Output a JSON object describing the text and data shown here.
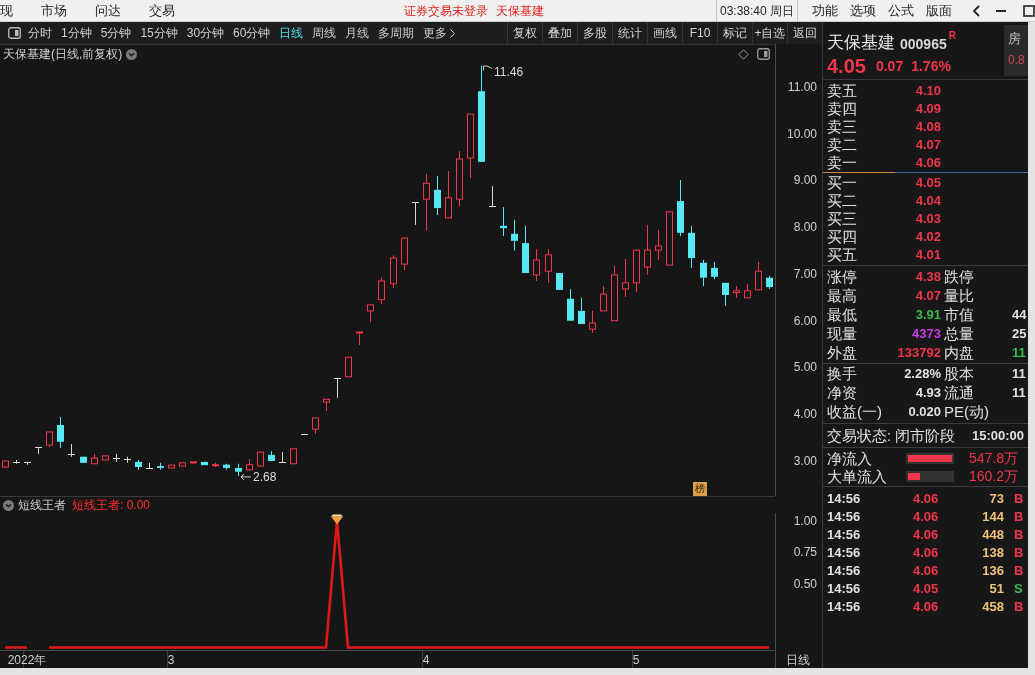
{
  "menu_bar": {
    "items": [
      "现",
      "市场",
      "问达",
      "交易"
    ],
    "login_status": "证券交易未登录",
    "stock": "天保基建",
    "clock": "03:38:40 周日",
    "options": [
      "功能",
      "选项",
      "公式",
      "版面"
    ]
  },
  "toolbar": {
    "periods": [
      {
        "label": "分时",
        "selected": false
      },
      {
        "label": "1分钟",
        "selected": false
      },
      {
        "label": "5分钟",
        "selected": false
      },
      {
        "label": "15分钟",
        "selected": false
      },
      {
        "label": "30分钟",
        "selected": false
      },
      {
        "label": "60分钟",
        "selected": false
      },
      {
        "label": "日线",
        "selected": true
      },
      {
        "label": "周线",
        "selected": false
      },
      {
        "label": "月线",
        "selected": false
      },
      {
        "label": "多周期",
        "selected": false
      },
      {
        "label": "更多",
        "selected": false
      }
    ],
    "actions": [
      "复权",
      "叠加",
      "多股",
      "统计",
      "画线",
      "F10",
      "标记",
      "+自选",
      "返回"
    ]
  },
  "chart": {
    "title": "天保基建(日线,前复权)",
    "badge": "榜",
    "indicator_name": "短线王者",
    "indicator_reading": "短线王者: 0.00",
    "period_label": "日线",
    "chart_data": [
      {
        "type": "candlestick",
        "categories": [
          null,
          null,
          null,
          null,
          null,
          null,
          null,
          null,
          null,
          null,
          null,
          null,
          null,
          null,
          null,
          null,
          null,
          null,
          null,
          null,
          null,
          null,
          null,
          null,
          null,
          null,
          null,
          null,
          null,
          null,
          null,
          null,
          null,
          null,
          null,
          null,
          null,
          null,
          null,
          null,
          null,
          null,
          null,
          null,
          null,
          null,
          null,
          null,
          null,
          null,
          null,
          null,
          null,
          null,
          null,
          null,
          null,
          null,
          null,
          null,
          null,
          null,
          null,
          null,
          null,
          null,
          null,
          null,
          null,
          null
        ],
        "ohlc": [
          [
            2.87,
            3.0,
            2.85,
            3.0
          ],
          [
            2.98,
            3.02,
            2.94,
            2.98
          ],
          [
            2.98,
            2.98,
            2.92,
            2.98
          ],
          [
            3.3,
            3.3,
            3.15,
            3.3
          ],
          [
            3.34,
            3.62,
            3.3,
            3.62
          ],
          [
            3.77,
            3.94,
            3.28,
            3.41
          ],
          [
            3.15,
            3.36,
            3.09,
            3.15
          ],
          [
            3.09,
            3.09,
            2.96,
            2.96
          ],
          [
            2.94,
            3.15,
            2.94,
            3.06
          ],
          [
            3.02,
            3.11,
            3.02,
            3.11
          ],
          [
            3.06,
            3.15,
            2.98,
            3.06
          ],
          [
            3.04,
            3.09,
            2.96,
            3.04
          ],
          [
            2.98,
            3.02,
            2.81,
            2.87
          ],
          [
            2.85,
            2.96,
            2.85,
            2.85
          ],
          [
            2.89,
            2.96,
            2.81,
            2.85
          ],
          [
            2.85,
            2.91,
            2.85,
            2.91
          ],
          [
            2.89,
            2.96,
            2.89,
            2.96
          ],
          [
            2.96,
            2.98,
            2.94,
            2.98
          ],
          [
            2.98,
            2.98,
            2.91,
            2.91
          ],
          [
            2.91,
            2.96,
            2.87,
            2.92
          ],
          [
            2.92,
            2.94,
            2.81,
            2.85
          ],
          [
            2.85,
            2.94,
            2.68,
            2.77
          ],
          [
            2.81,
            3.04,
            2.81,
            2.92
          ],
          [
            2.89,
            3.19,
            2.87,
            3.19
          ],
          [
            3.13,
            3.21,
            3.0,
            3.0
          ],
          [
            2.98,
            3.19,
            2.98,
            2.98
          ],
          [
            2.94,
            3.26,
            2.94,
            3.26
          ],
          [
            3.58,
            3.58,
            3.58,
            3.58
          ],
          [
            3.68,
            3.92,
            3.58,
            3.92
          ],
          [
            4.26,
            4.32,
            4.07,
            4.32
          ],
          [
            4.78,
            4.78,
            4.35,
            4.78
          ],
          [
            4.8,
            5.22,
            4.8,
            5.22
          ],
          [
            5.74,
            5.76,
            5.48,
            5.76
          ],
          [
            6.21,
            6.34,
            5.97,
            6.34
          ],
          [
            6.45,
            6.92,
            6.35,
            6.85
          ],
          [
            6.79,
            7.4,
            6.7,
            7.34
          ],
          [
            7.21,
            7.77,
            7.08,
            7.77
          ],
          [
            8.54,
            8.54,
            8.05,
            8.54
          ],
          [
            8.6,
            9.14,
            7.93,
            8.94
          ],
          [
            8.8,
            9.1,
            8.26,
            8.41
          ],
          [
            8.2,
            9.2,
            8.2,
            8.63
          ],
          [
            8.6,
            9.63,
            8.45,
            9.46
          ],
          [
            9.48,
            10.42,
            9.05,
            10.42
          ],
          [
            10.91,
            11.46,
            9.4,
            9.4
          ],
          [
            8.45,
            8.88,
            8.45,
            8.45
          ],
          [
            8.03,
            8.43,
            7.81,
            7.98
          ],
          [
            7.86,
            8.16,
            7.5,
            7.71
          ],
          [
            7.66,
            8.03,
            7.02,
            7.02
          ],
          [
            6.98,
            7.53,
            6.85,
            7.3
          ],
          [
            7.06,
            7.53,
            6.81,
            7.41
          ],
          [
            7.02,
            7.02,
            6.66,
            6.66
          ],
          [
            6.47,
            6.68,
            6.0,
            6.0
          ],
          [
            6.21,
            6.49,
            5.93,
            5.93
          ],
          [
            5.82,
            6.21,
            5.74,
            5.95
          ],
          [
            6.21,
            6.74,
            6.21,
            6.57
          ],
          [
            6.0,
            7.17,
            6.0,
            6.98
          ],
          [
            6.68,
            7.32,
            6.51,
            6.81
          ],
          [
            6.81,
            7.51,
            6.61,
            7.51
          ],
          [
            7.15,
            8.05,
            6.98,
            7.51
          ],
          [
            7.51,
            7.94,
            7.3,
            7.6
          ],
          [
            7.19,
            8.33,
            7.19,
            8.33
          ],
          [
            8.56,
            9.01,
            7.81,
            7.88
          ],
          [
            7.88,
            8.03,
            7.13,
            7.34
          ],
          [
            7.24,
            7.3,
            6.74,
            6.92
          ],
          [
            7.13,
            7.26,
            6.89,
            6.94
          ],
          [
            6.81,
            6.81,
            6.32,
            6.55
          ],
          [
            6.6,
            6.74,
            6.49,
            6.64
          ],
          [
            6.49,
            6.79,
            6.49,
            6.64
          ],
          [
            6.66,
            7.26,
            6.66,
            7.06
          ],
          [
            6.92,
            6.96,
            6.68,
            6.72
          ]
        ],
        "ylim": [
          2.25,
          11.92
        ],
        "yticks": [
          {
            "value": 11,
            "label": "11.00"
          },
          {
            "value": 10,
            "label": "10.00"
          },
          {
            "value": 9,
            "label": "9.00"
          },
          {
            "value": 8,
            "label": "8.00"
          },
          {
            "value": 7,
            "label": "7.00"
          },
          {
            "value": 6,
            "label": "6.00"
          },
          {
            "value": 5,
            "label": "5.00"
          },
          {
            "value": 4,
            "label": "4.00"
          },
          {
            "value": 3,
            "label": "3.00"
          }
        ],
        "annotations": [
          "11.46",
          "2.68"
        ]
      },
      {
        "type": "line",
        "color": "#e01818",
        "categories": [
          null,
          null,
          "2022年",
          null,
          null,
          null,
          null,
          null,
          null,
          null,
          null,
          null,
          null,
          null,
          null,
          "3",
          null,
          null,
          null,
          null,
          null,
          null,
          null,
          null,
          null,
          null,
          null,
          null,
          null,
          null,
          null,
          null,
          null,
          null,
          null,
          null,
          null,
          null,
          "4",
          null,
          null,
          null,
          null,
          null,
          null,
          null,
          null,
          null,
          null,
          null,
          null,
          null,
          null,
          null,
          null,
          null,
          null,
          "5",
          null,
          null,
          null,
          null,
          null,
          null,
          null,
          null,
          null,
          null,
          null,
          null
        ],
        "values": [
          0,
          0,
          0,
          null,
          0,
          0,
          0,
          0,
          0,
          0,
          0,
          0,
          0,
          0,
          0,
          0,
          0,
          0,
          0,
          0,
          0,
          0,
          0,
          0,
          0,
          0,
          0,
          0,
          0,
          0,
          1,
          0,
          0,
          0,
          0,
          0,
          0,
          0,
          0,
          0,
          0,
          0,
          0,
          0,
          0,
          0,
          0,
          0,
          0,
          0,
          0,
          0,
          0,
          0,
          0,
          0,
          0,
          0,
          0,
          0,
          0,
          0,
          0,
          0,
          0,
          0,
          0,
          0,
          0,
          0
        ],
        "ylim": [
          -0.02,
          1.06
        ],
        "yticks": [
          {
            "value": 1,
            "label": "1.00"
          },
          {
            "value": 0.75,
            "label": "0.75"
          },
          {
            "value": 0.5,
            "label": "0.50"
          }
        ]
      }
    ]
  },
  "quote": {
    "name": "天保基建",
    "code": "000965",
    "suffix": "R",
    "price": "4.05",
    "change": "0.07",
    "change_pct": "1.76%"
  },
  "side_tab": {
    "label": "房",
    "value": "0.8"
  },
  "order_book": {
    "asks": [
      {
        "label": "卖五",
        "price": "4.10"
      },
      {
        "label": "卖四",
        "price": "4.09"
      },
      {
        "label": "卖三",
        "price": "4.08"
      },
      {
        "label": "卖二",
        "price": "4.07"
      },
      {
        "label": "卖一",
        "price": "4.06"
      }
    ],
    "bids": [
      {
        "label": "买一",
        "price": "4.05"
      },
      {
        "label": "买二",
        "price": "4.04"
      },
      {
        "label": "买三",
        "price": "4.03"
      },
      {
        "label": "买四",
        "price": "4.02"
      },
      {
        "label": "买五",
        "price": "4.01"
      }
    ]
  },
  "stats": [
    [
      {
        "label": "涨停",
        "value": "4.38",
        "color": "#f0364b"
      },
      {
        "label": "跌停"
      }
    ],
    [
      {
        "label": "最高",
        "value": "4.07",
        "color": "#f0364b"
      },
      {
        "label": "量比"
      }
    ],
    [
      {
        "label": "最低",
        "value": "3.91",
        "color": "#3dbb4f"
      },
      {
        "label": "市值",
        "value": "44",
        "color": "#e2e2e2"
      }
    ],
    [
      {
        "label": "现量",
        "value": "4373",
        "color": "#c43de0"
      },
      {
        "label": "总量",
        "value": "25",
        "color": "#e2e2e2"
      }
    ],
    [
      {
        "label": "外盘",
        "value": "133792",
        "color": "#f0364b"
      },
      {
        "label": "内盘",
        "value": "11",
        "color": "#3dbb4f"
      }
    ]
  ],
  "fundamentals": [
    [
      {
        "label": "换手",
        "value": "2.28%"
      },
      {
        "label": "股本",
        "value": "11"
      }
    ],
    [
      {
        "label": "净资",
        "value": "4.93"
      },
      {
        "label": "流通",
        "value": "11"
      }
    ],
    [
      {
        "label": "收益(一)",
        "value": "0.020"
      },
      {
        "label": "PE(动)"
      }
    ]
  ],
  "trade_status": {
    "label": "交易状态: 闭市阶段",
    "time": "15:00:00"
  },
  "flows": [
    {
      "label": "净流入",
      "level": 1.0,
      "value": "547.8万"
    },
    {
      "label": "大单流入",
      "level": 0.28,
      "value": "160.2万"
    }
  ],
  "ticks": [
    {
      "time": "14:56",
      "price": "4.06",
      "volume": "73",
      "side": "B",
      "kind": "buy"
    },
    {
      "time": "14:56",
      "price": "4.06",
      "volume": "144",
      "side": "B",
      "kind": "buy"
    },
    {
      "time": "14:56",
      "price": "4.06",
      "volume": "448",
      "side": "B",
      "kind": "buy"
    },
    {
      "time": "14:56",
      "price": "4.06",
      "volume": "138",
      "side": "B",
      "kind": "buy"
    },
    {
      "time": "14:56",
      "price": "4.06",
      "volume": "136",
      "side": "B",
      "kind": "buy"
    },
    {
      "time": "14:56",
      "price": "4.05",
      "volume": "51",
      "side": "S",
      "kind": "sell"
    },
    {
      "time": "14:56",
      "price": "4.06",
      "volume": "458",
      "side": "B",
      "kind": "buy"
    }
  ]
}
